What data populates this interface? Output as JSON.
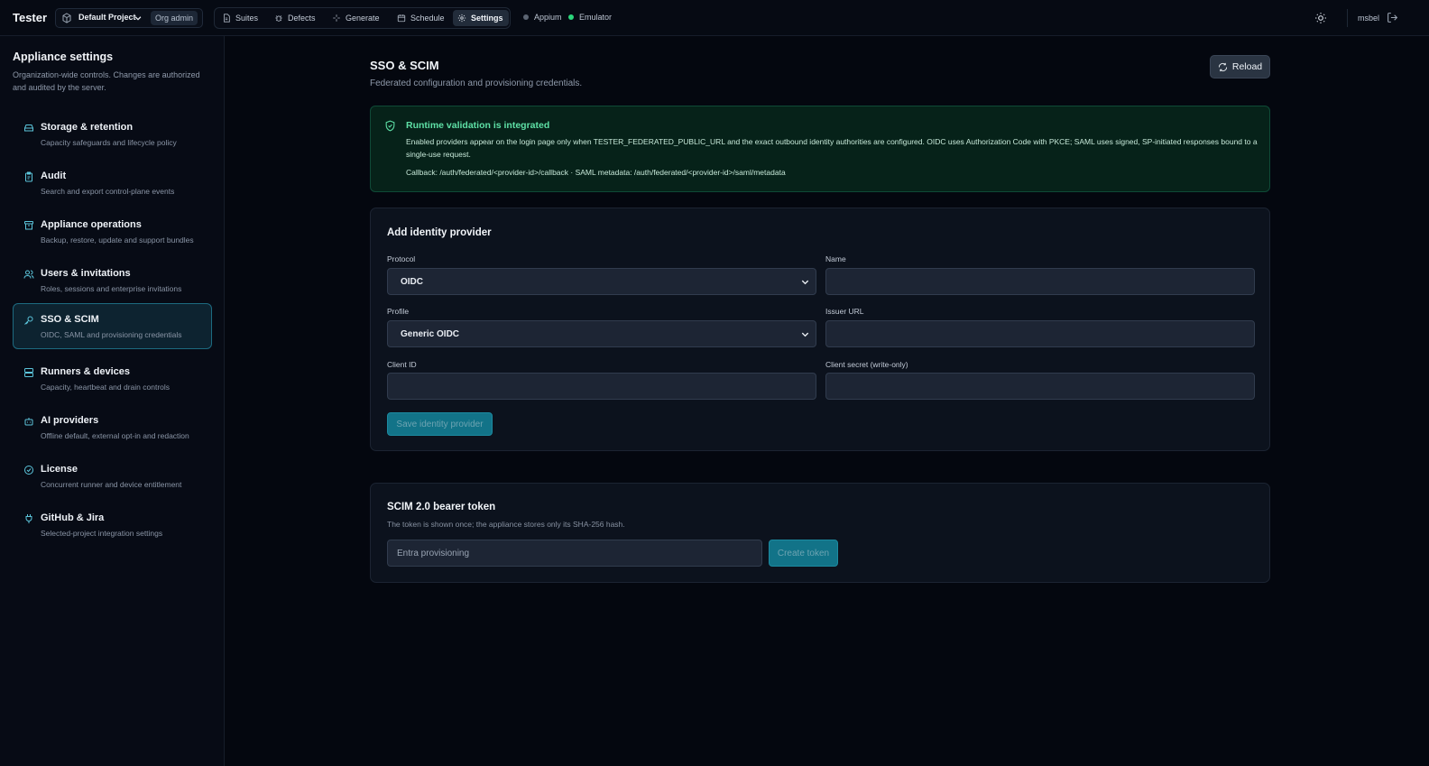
{
  "app": {
    "title": "Tester"
  },
  "project": {
    "name": "Default Project",
    "role_badge": "Org admin"
  },
  "nav": [
    {
      "label": "Suites",
      "icon": "file-icon"
    },
    {
      "label": "Defects",
      "icon": "bug-icon"
    },
    {
      "label": "Generate",
      "icon": "sparkle-icon"
    },
    {
      "label": "Schedule",
      "icon": "calendar-icon"
    },
    {
      "label": "Settings",
      "icon": "gear-icon"
    }
  ],
  "status": [
    {
      "label": "Appium",
      "color": "#5b6472"
    },
    {
      "label": "Emulator",
      "color": "#2bd67b"
    }
  ],
  "user": {
    "name": "msbel"
  },
  "sidebar": {
    "title": "Appliance settings",
    "description": "Organization-wide controls. Changes are authorized and audited by the server.",
    "items": [
      {
        "label": "Storage & retention",
        "sub": "Capacity safeguards and lifecycle policy",
        "icon": "storage-icon"
      },
      {
        "label": "Audit",
        "sub": "Search and export control-plane events",
        "icon": "clipboard-icon"
      },
      {
        "label": "Appliance operations",
        "sub": "Backup, restore, update and support bundles",
        "icon": "archive-icon"
      },
      {
        "label": "Users & invitations",
        "sub": "Roles, sessions and enterprise invitations",
        "icon": "users-icon"
      },
      {
        "label": "SSO & SCIM",
        "sub": "OIDC, SAML and provisioning credentials",
        "icon": "key-icon",
        "active": true
      },
      {
        "label": "Runners & devices",
        "sub": "Capacity, heartbeat and drain controls",
        "icon": "server-icon"
      },
      {
        "label": "AI providers",
        "sub": "Offline default, external opt-in and redaction",
        "icon": "bot-icon"
      },
      {
        "label": "License",
        "sub": "Concurrent runner and device entitlement",
        "icon": "check-circle-icon"
      },
      {
        "label": "GitHub & Jira",
        "sub": "Selected-project integration settings",
        "icon": "plug-icon"
      }
    ]
  },
  "page": {
    "title": "SSO & SCIM",
    "subtitle": "Federated configuration and provisioning credentials.",
    "reload_label": "Reload"
  },
  "alert": {
    "title": "Runtime validation is integrated",
    "body": "Enabled providers appear on the login page only when TESTER_FEDERATED_PUBLIC_URL and the exact outbound identity authorities are configured. OIDC uses Authorization Code with PKCE; SAML uses signed, SP-initiated responses bound to a single-use request.",
    "callback": "Callback: /auth/federated/<provider-id>/callback · SAML metadata: /auth/federated/<provider-id>/saml/metadata"
  },
  "idp_form": {
    "title": "Add identity provider",
    "protocol_label": "Protocol",
    "protocol_value": "OIDC",
    "name_label": "Name",
    "name_value": "",
    "profile_label": "Profile",
    "profile_value": "Generic OIDC",
    "issuer_label": "Issuer URL",
    "issuer_value": "",
    "client_id_label": "Client ID",
    "client_id_value": "",
    "client_secret_label": "Client secret (write-only)",
    "client_secret_value": "",
    "save_label": "Save identity provider"
  },
  "scim": {
    "title": "SCIM 2.0 bearer token",
    "description": "The token is shown once; the appliance stores only its SHA-256 hash.",
    "input_placeholder": "Entra provisioning",
    "create_label": "Create token"
  }
}
